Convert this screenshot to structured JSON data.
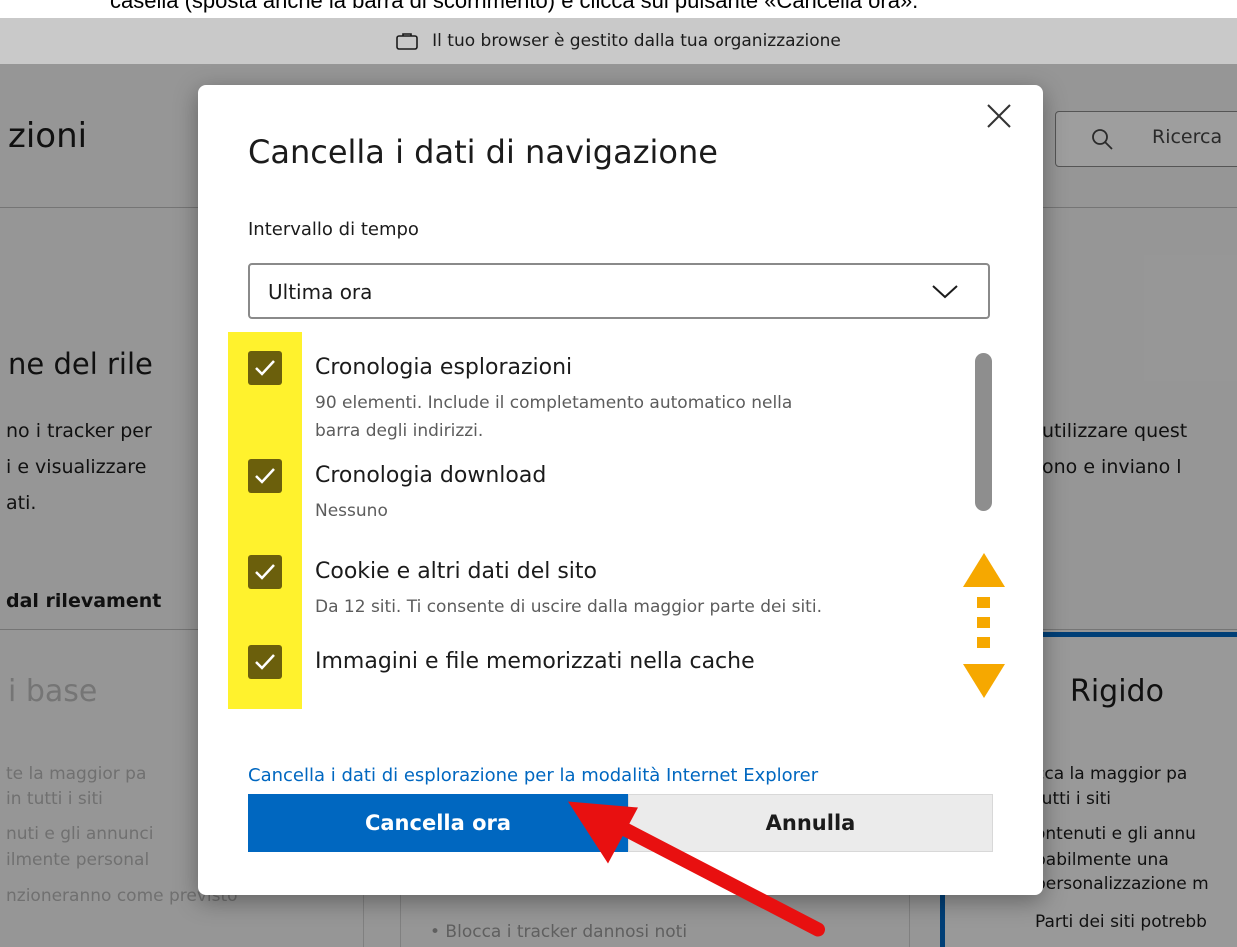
{
  "caption": {
    "text": "casella (sposta anche la barra di scorrimento) e clicca sul pulsante «Cancella ora»."
  },
  "managed_bar": {
    "icon": "briefcase-icon",
    "text": "Il tuo browser è gestito dalla tua organizzazione"
  },
  "background_page": {
    "title": "zioni",
    "search_placeholder": "Ricerca",
    "section_title": "ne del rile",
    "left_lines": [
      "no i tracker per",
      "i e visualizzare",
      "ati."
    ],
    "right_lines": [
      "utilizzare quest",
      "ono e inviano l"
    ],
    "tab_label": "dal rilevament",
    "card_left": {
      "title": "i base",
      "lines": [
        "te la maggior pa",
        "in tutti i siti",
        "nuti e gli annunci",
        "ilmente personal",
        "nzioneranno come previsto"
      ]
    },
    "card_right": {
      "title": "Rigido",
      "lines": [
        "cca la maggior pa",
        "tutti i siti",
        "ontenuti e gli annu",
        "babilmente una",
        "personalizzazione m",
        "Parti dei siti potrebb"
      ]
    },
    "middle_bullet": "•   Blocca i tracker dannosi noti"
  },
  "dialog": {
    "title": "Cancella i dati di navigazione",
    "time_range_label": "Intervallo di tempo",
    "time_range_value": "Ultima ora",
    "items": [
      {
        "title": "Cronologia esplorazioni",
        "desc": [
          "90 elementi. Include il completamento automatico nella",
          "barra degli indirizzi."
        ],
        "checked": true
      },
      {
        "title": "Cronologia download",
        "desc": [
          "Nessuno"
        ],
        "checked": true
      },
      {
        "title": "Cookie e altri dati del sito",
        "desc": [
          "Da 12 siti. Ti consente di uscire dalla maggior parte dei siti."
        ],
        "checked": true
      },
      {
        "title": "Immagini e file memorizzati nella cache",
        "desc": [],
        "checked": true
      }
    ],
    "ie_link": "Cancella i dati di esplorazione per la modalità Internet Explorer",
    "primary_button": "Cancella ora",
    "secondary_button": "Annulla"
  },
  "colors": {
    "accent": "#0067c0",
    "highlight": "#fff22d",
    "annotation_orange": "#f6a800",
    "annotation_red": "#e81010",
    "checkbox": "#6b5f0c"
  }
}
